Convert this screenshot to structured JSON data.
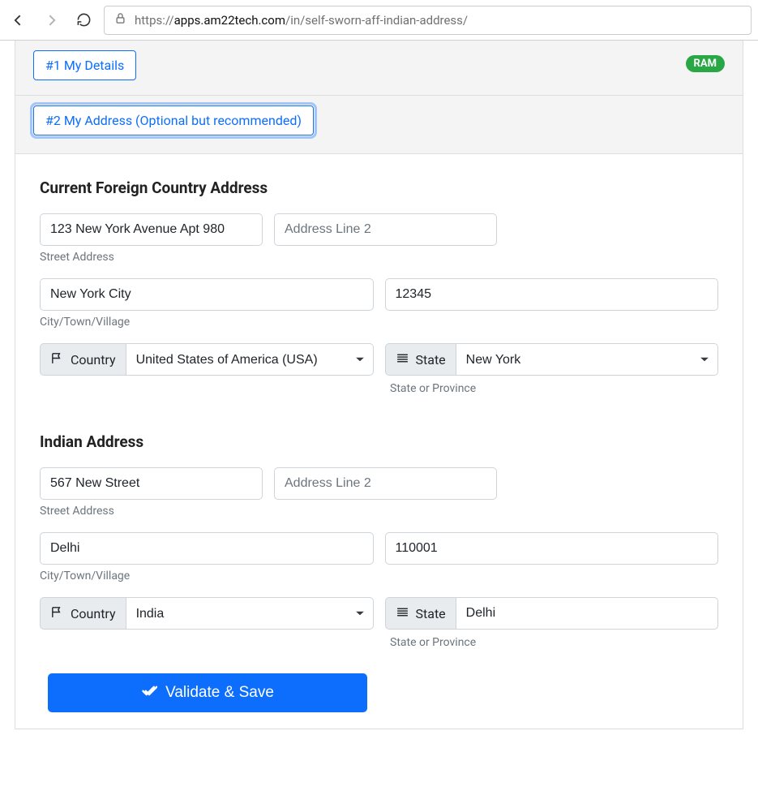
{
  "browser": {
    "url_prefix": "https://",
    "url_host": "apps.am22tech.com",
    "url_path": "/in/self-sworn-aff-indian-address/"
  },
  "tabs": {
    "details": "#1 My Details",
    "address": "#2 My Address (Optional but recommended)"
  },
  "badge": "RAM",
  "foreign": {
    "title": "Current Foreign Country Address",
    "addr1": "123 New York Avenue Apt 980",
    "addr2_placeholder": "Address Line 2",
    "street_label": "Street Address",
    "city": "New York City",
    "zip": "12345",
    "city_label": "City/Town/Village",
    "country_label": "Country",
    "country": "United States of America (USA)",
    "state_label": "State",
    "state": "New York",
    "state_help": "State or Province"
  },
  "indian": {
    "title": "Indian Address",
    "addr1": "567 New Street",
    "addr2_placeholder": "Address Line 2",
    "street_label": "Street Address",
    "city": "Delhi",
    "zip": "110001",
    "city_label": "City/Town/Village",
    "country_label": "Country",
    "country": "India",
    "state_label": "State",
    "state": "Delhi",
    "state_help": "State or Province"
  },
  "validate_label": "Validate & Save"
}
